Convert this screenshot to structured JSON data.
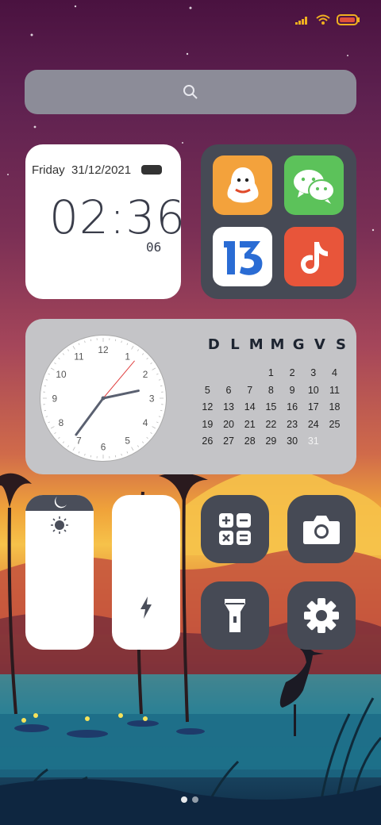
{
  "status_bar": {
    "signal_icon": "signal-bars-icon",
    "wifi_icon": "wifi-icon",
    "battery_icon": "battery-icon"
  },
  "search": {
    "icon": "search-icon"
  },
  "clock_widget": {
    "day": "Friday",
    "date": "31/12/2021",
    "hours": "02",
    "minutes": "36",
    "seconds": "06"
  },
  "apps": [
    {
      "name": "QQ",
      "icon": "qq-penguin-icon",
      "color": "#f3a23c"
    },
    {
      "name": "WeChat",
      "icon": "wechat-icon",
      "color": "#5cc25a"
    },
    {
      "name": "13",
      "icon": "thirteen-app-icon",
      "color": "#ffffff"
    },
    {
      "name": "TikTok",
      "icon": "tiktok-icon",
      "color": "#e8553a"
    }
  ],
  "calendar_widget": {
    "weekdays": [
      "D",
      "L",
      "M",
      "M",
      "G",
      "V",
      "S"
    ],
    "days": [
      "",
      "",
      "",
      "1",
      "2",
      "3",
      "4",
      "5",
      "6",
      "7",
      "8",
      "9",
      "10",
      "11",
      "12",
      "13",
      "14",
      "15",
      "16",
      "17",
      "18",
      "19",
      "20",
      "21",
      "22",
      "23",
      "24",
      "25",
      "26",
      "27",
      "28",
      "29",
      "30",
      "31",
      ""
    ],
    "today": "31",
    "analog_clock": {
      "numbers": [
        "12",
        "1",
        "2",
        "3",
        "4",
        "5",
        "6",
        "7",
        "8",
        "9",
        "10",
        "11"
      ],
      "hour": 2,
      "minute": 36,
      "second": 6
    }
  },
  "sliders": [
    {
      "name": "brightness",
      "icons": [
        "moon-icon",
        "sun-icon"
      ]
    },
    {
      "name": "battery",
      "icons": [
        "lightning-icon"
      ]
    }
  ],
  "tiles": [
    {
      "name": "calculator",
      "icon": "calculator-icon"
    },
    {
      "name": "camera",
      "icon": "camera-icon"
    },
    {
      "name": "flashlight",
      "icon": "flashlight-icon"
    },
    {
      "name": "settings",
      "icon": "settings-gear-icon"
    }
  ],
  "colors": {
    "widget_dark": "#464a55",
    "search_bg": "#8c8c98",
    "calendar_bg": "#c4c4c7"
  }
}
